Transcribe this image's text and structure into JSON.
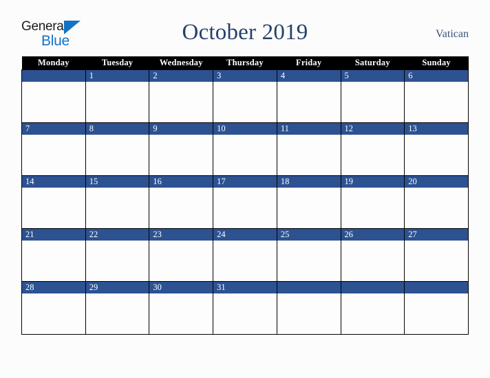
{
  "brand": {
    "name_part1": "General",
    "name_part2": "Blue",
    "triangle_color": "#1272c4"
  },
  "header": {
    "title": "October 2019",
    "month": "October",
    "year": "2019",
    "region": "Vatican"
  },
  "colors": {
    "header_row_bg": "#000000",
    "day_band_bg": "#2d5292",
    "title_text": "#27406b",
    "region_text": "#3a5079",
    "page_bg": "#fcfcfd",
    "cell_bg": "#fdfdfd",
    "grid_line": "#000000"
  },
  "calendar": {
    "weekday_headers": [
      "Monday",
      "Tuesday",
      "Wednesday",
      "Thursday",
      "Friday",
      "Saturday",
      "Sunday"
    ],
    "weeks": [
      [
        "",
        "1",
        "2",
        "3",
        "4",
        "5",
        "6"
      ],
      [
        "7",
        "8",
        "9",
        "10",
        "11",
        "12",
        "13"
      ],
      [
        "14",
        "15",
        "16",
        "17",
        "18",
        "19",
        "20"
      ],
      [
        "21",
        "22",
        "23",
        "24",
        "25",
        "26",
        "27"
      ],
      [
        "28",
        "29",
        "30",
        "31",
        "",
        "",
        ""
      ]
    ]
  }
}
